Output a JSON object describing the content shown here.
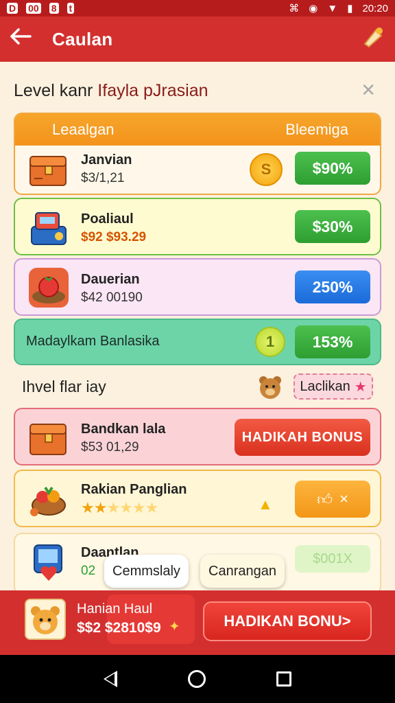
{
  "status_bar": {
    "icons_left": [
      "D",
      "00",
      "8",
      "t"
    ],
    "time": "20:20"
  },
  "app_bar": {
    "title": "Caulan",
    "back_icon": "arrow-left-icon",
    "action_icon": "bell-icon"
  },
  "sheet": {
    "title_part1": "Level kanr ",
    "title_part2": "Ifayla pJ",
    "title_part3": "rasian",
    "close_icon": "close-icon",
    "header": {
      "left": "Leaalgan",
      "right": "Bleemiga"
    },
    "rows": [
      {
        "name": "Janvian",
        "sub": "$3/1,21",
        "coin": "S",
        "pct": "$90%",
        "btn_color": "green"
      },
      {
        "name": "Poaliaul",
        "sub": "$92 $93.29",
        "pct": "$30%",
        "btn_color": "green"
      },
      {
        "name": "Dauerian",
        "sub": "$42 00190",
        "pct": "250%",
        "btn_color": "blue"
      },
      {
        "name": "Madaylkam Banlasika",
        "coin": "1",
        "pct": "153%",
        "btn_color": "green"
      }
    ],
    "section_label": "Ihvel flar iay",
    "tag": {
      "label": "Laclikan"
    },
    "bonus_rows": [
      {
        "name": "Bandkan lala",
        "sub": "$53 01,29",
        "button": "HADIKAH BONUS"
      },
      {
        "name": "Rakian Panglian",
        "rating": 2,
        "rating_max": 6,
        "button_suffix": "×"
      },
      {
        "name": "Daantlan",
        "sub": "02",
        "pct": "$001X"
      }
    ],
    "chips": [
      "Cemmslaly",
      "Canrangan"
    ]
  },
  "bottom_bar": {
    "name": "Hanian Haul",
    "value": "$$2 $2810$9",
    "button": "HADIKAN BONU>"
  },
  "colors": {
    "primary": "#d32f2f",
    "green": "#2e9e31",
    "blue": "#1a6ad9",
    "orange": "#f3931c"
  }
}
